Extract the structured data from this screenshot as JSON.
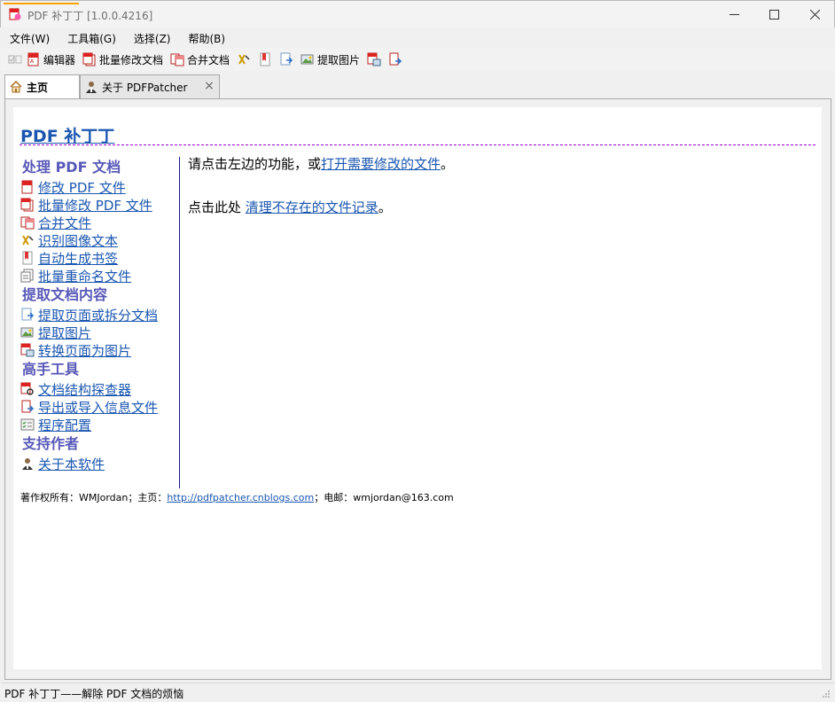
{
  "window": {
    "title": "PDF 补丁丁 [1.0.0.4216]"
  },
  "menu": [
    "文件(W)",
    "工具箱(G)",
    "选择(Z)",
    "帮助(B)"
  ],
  "toolbar": {
    "editor_label": "编辑器",
    "batch_label": "批量修改文档",
    "merge_label": "合并文档",
    "extract_images_label": "提取图片"
  },
  "tabs": {
    "home_label": "主页",
    "about_label": "关于 PDFPatcher"
  },
  "page": {
    "title": "PDF 补丁丁",
    "sections": [
      {
        "heading": "处理 PDF 文档",
        "links": [
          "修改 PDF 文件",
          "批量修改 PDF 文件",
          "合并文件",
          "识别图像文本",
          "自动生成书签",
          "批量重命名文件"
        ]
      },
      {
        "heading": "提取文档内容",
        "links": [
          "提取页面或拆分文档",
          "提取图片",
          "转换页面为图片"
        ]
      },
      {
        "heading": "高手工具",
        "links": [
          "文档结构探查器",
          "导出或导入信息文件",
          "程序配置"
        ]
      },
      {
        "heading": "支持作者",
        "links": [
          "关于本软件"
        ]
      }
    ],
    "main_prefix": "请点击左边的功能，或",
    "main_link": "打开需要修改的文件",
    "main_suffix": "。",
    "cleanup_prefix": "点击此处 ",
    "cleanup_link": "清理不存在的文件记录",
    "cleanup_suffix": "。",
    "footer_prefix": "著作权所有：WMJordan；主页：",
    "footer_link": "http://pdfpatcher.cnblogs.com",
    "footer_suffix": "；电邮：wmjordan@163.com"
  },
  "status": {
    "text": "PDF 补丁丁——解除 PDF 文档的烦恼"
  },
  "colors": {
    "link": "#1a56b0",
    "heading": "#5858b8",
    "rule": "#9900cc",
    "tab_accent": "#ffa200"
  }
}
